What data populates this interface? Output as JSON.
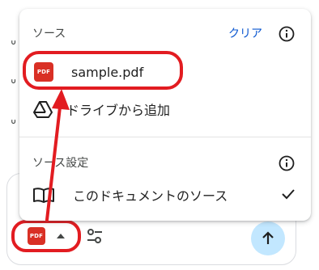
{
  "menu": {
    "sources_title": "ソース",
    "clear_label": "クリア",
    "items": [
      {
        "label": "sample.pdf",
        "icon": "pdf-icon",
        "icon_text": "PDF"
      },
      {
        "label": "ドライブから追加",
        "icon": "google-drive-icon"
      }
    ],
    "settings_title": "ソース設定",
    "settings_items": [
      {
        "label": "このドキュメントのソース",
        "icon": "book-icon",
        "checked": true
      }
    ]
  },
  "composer": {
    "source_chip_icon_text": "PDF"
  },
  "colors": {
    "accent_blue": "#0b57d0",
    "pdf_red": "#d93025",
    "annotation_red": "#e21c21",
    "send_bg": "#c2e7ff"
  }
}
